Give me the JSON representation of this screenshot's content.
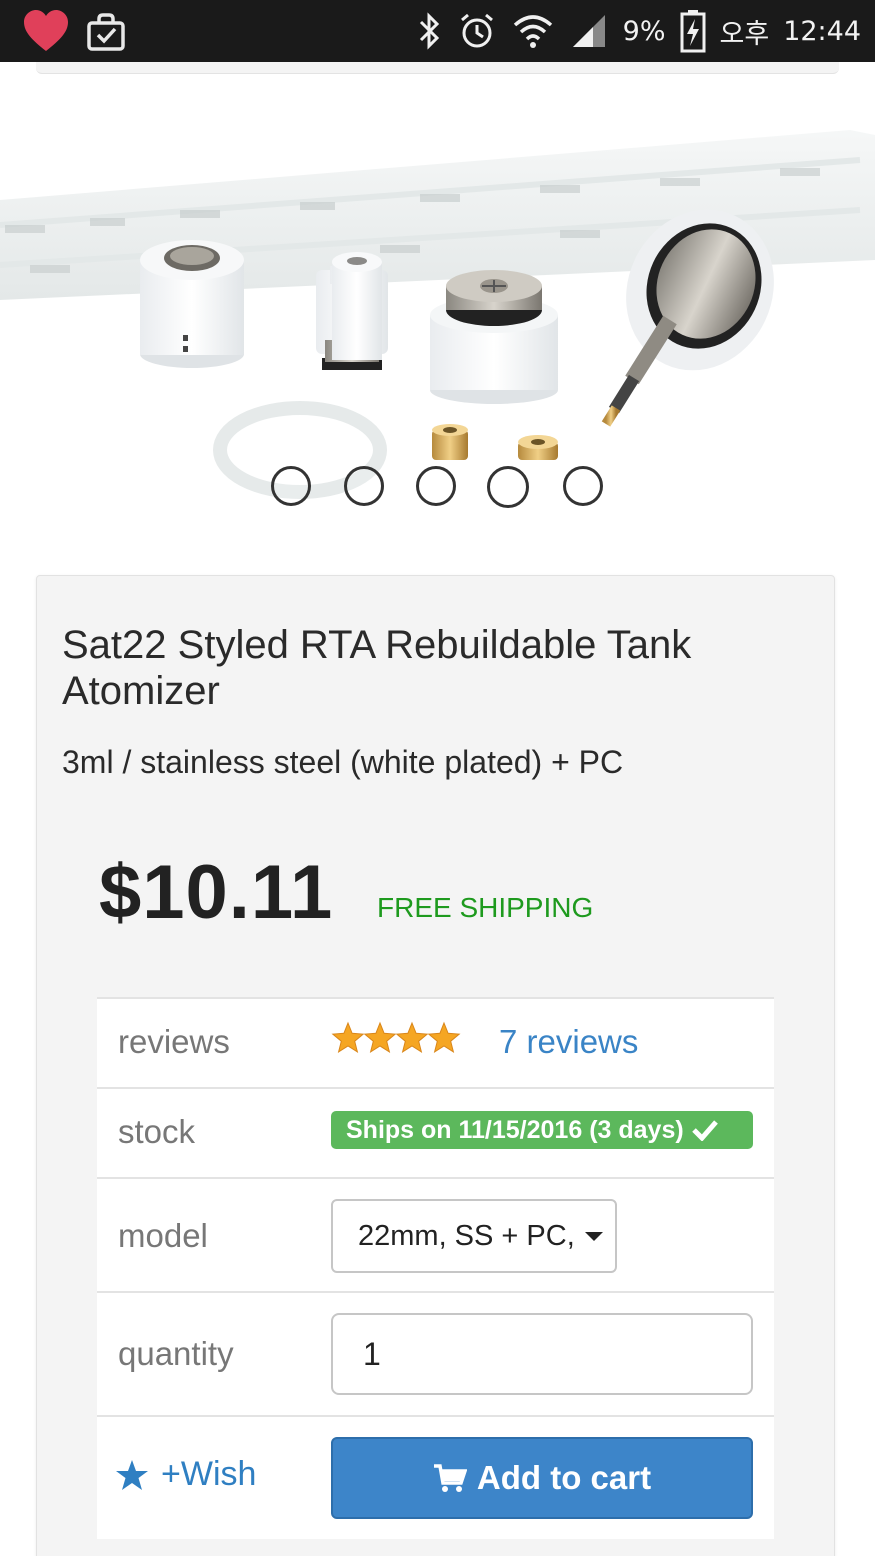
{
  "status_bar": {
    "battery": "9%",
    "ampm": "오후",
    "time": "12:44"
  },
  "product": {
    "title": "Sat22 Styled RTA Rebuildable Tank Atomizer",
    "subtitle": "3ml / stainless steel (white plated) + PC",
    "price": "$10.11",
    "shipping": "FREE SHIPPING"
  },
  "attributes": {
    "reviews_label": "reviews",
    "rating_stars": 4,
    "reviews_link": "7 reviews",
    "stock_label": "stock",
    "stock_status": "Ships on 11/15/2016 (3 days)",
    "model_label": "model",
    "model_value": "22mm, SS + PC,",
    "quantity_label": "quantity",
    "quantity_value": "1"
  },
  "actions": {
    "wish": "+Wish",
    "add_to_cart": "Add to cart"
  },
  "carousel": {
    "slide_count": 5
  },
  "colors": {
    "accent_blue": "#3d85c9",
    "free_shipping_green": "#1e9a1e",
    "stock_badge_green": "#5cb85c",
    "star_orange": "#f5a623"
  }
}
